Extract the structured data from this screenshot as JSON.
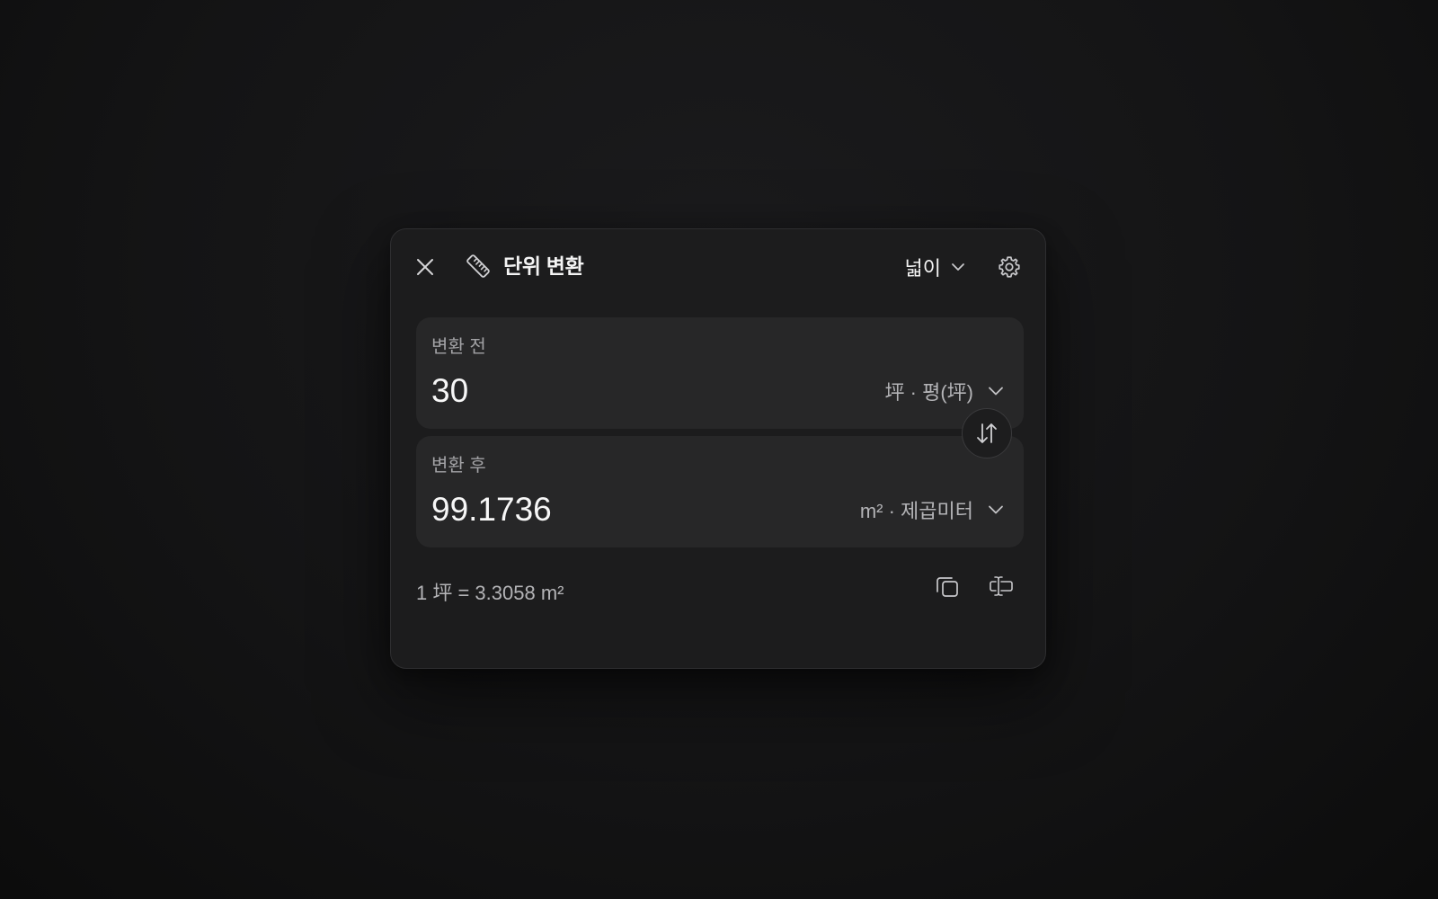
{
  "header": {
    "close_icon": "close-icon",
    "app_icon": "ruler-icon",
    "title": "단위 변환",
    "category": "넓이",
    "category_icon": "chevron-down-icon",
    "settings_icon": "gear-icon"
  },
  "from": {
    "label": "변환 전",
    "value": "30",
    "unit": "坪 · 평(坪)"
  },
  "to": {
    "label": "변환 후",
    "value": "99.1736",
    "unit": "m² · 제곱미터"
  },
  "swap_icon": "swap-vertical-icon",
  "footer": {
    "rate": "1 坪 = 3.3058 m²",
    "copy_icon": "copy-icon",
    "text_cursor_icon": "text-cursor-icon"
  },
  "colors": {
    "background": "#141415",
    "panel": "#1c1c1d",
    "field": "#272728",
    "text_primary": "#f4f4f4",
    "text_secondary": "#a3a3a6"
  }
}
